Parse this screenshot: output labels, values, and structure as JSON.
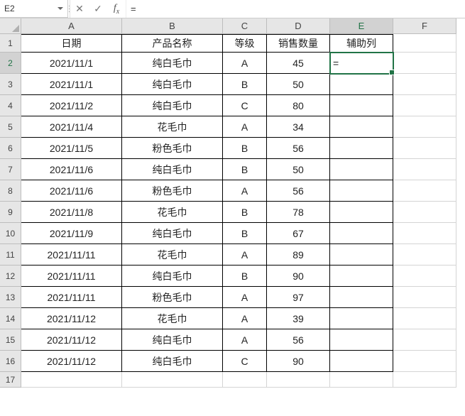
{
  "name_box": {
    "cell_ref": "E2"
  },
  "formula_bar": {
    "cancel_glyph": "✕",
    "enter_glyph": "✓",
    "fx_label": "fx",
    "value": "="
  },
  "columns": {
    "A": "A",
    "B": "B",
    "C": "C",
    "D": "D",
    "E": "E",
    "F": "F"
  },
  "headers": {
    "date": "日期",
    "product": "产品名称",
    "grade": "等级",
    "qty": "销售数量",
    "aux": "辅助列"
  },
  "active_cell_value": "=",
  "rows": [
    {
      "n": "1"
    },
    {
      "n": "2",
      "date": "2021/11/1",
      "product": "纯白毛巾",
      "grade": "A",
      "qty": "45"
    },
    {
      "n": "3",
      "date": "2021/11/1",
      "product": "纯白毛巾",
      "grade": "B",
      "qty": "50"
    },
    {
      "n": "4",
      "date": "2021/11/2",
      "product": "纯白毛巾",
      "grade": "C",
      "qty": "80"
    },
    {
      "n": "5",
      "date": "2021/11/4",
      "product": "花毛巾",
      "grade": "A",
      "qty": "34"
    },
    {
      "n": "6",
      "date": "2021/11/5",
      "product": "粉色毛巾",
      "grade": "B",
      "qty": "56"
    },
    {
      "n": "7",
      "date": "2021/11/6",
      "product": "纯白毛巾",
      "grade": "B",
      "qty": "50"
    },
    {
      "n": "8",
      "date": "2021/11/6",
      "product": "粉色毛巾",
      "grade": "A",
      "qty": "56"
    },
    {
      "n": "9",
      "date": "2021/11/8",
      "product": "花毛巾",
      "grade": "B",
      "qty": "78"
    },
    {
      "n": "10",
      "date": "2021/11/9",
      "product": "纯白毛巾",
      "grade": "B",
      "qty": "67"
    },
    {
      "n": "11",
      "date": "2021/11/11",
      "product": "花毛巾",
      "grade": "A",
      "qty": "89"
    },
    {
      "n": "12",
      "date": "2021/11/11",
      "product": "纯白毛巾",
      "grade": "B",
      "qty": "90"
    },
    {
      "n": "13",
      "date": "2021/11/11",
      "product": "粉色毛巾",
      "grade": "A",
      "qty": "97"
    },
    {
      "n": "14",
      "date": "2021/11/12",
      "product": "花毛巾",
      "grade": "A",
      "qty": "39"
    },
    {
      "n": "15",
      "date": "2021/11/12",
      "product": "纯白毛巾",
      "grade": "A",
      "qty": "56"
    },
    {
      "n": "16",
      "date": "2021/11/12",
      "product": "纯白毛巾",
      "grade": "C",
      "qty": "90"
    },
    {
      "n": "17"
    }
  ]
}
